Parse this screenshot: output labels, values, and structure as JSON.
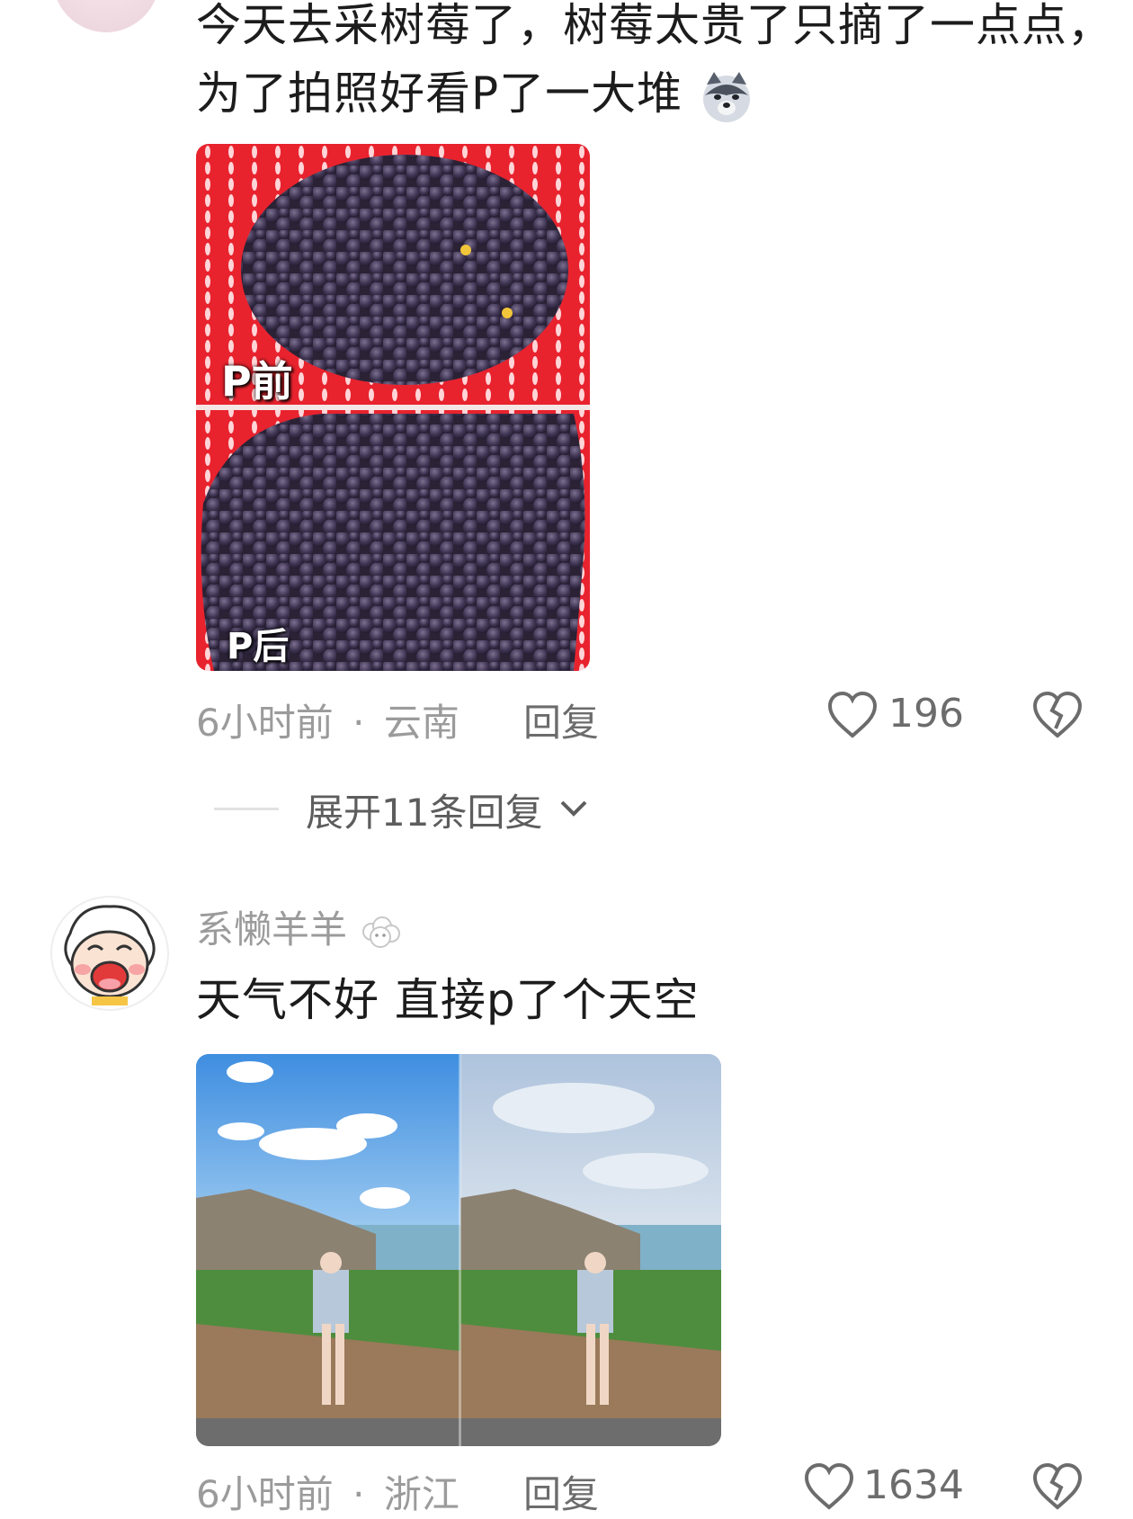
{
  "comments": [
    {
      "text_line1": "今天去采树莓了，树莓太贵了只摘了一点点，",
      "text_line2": "为了拍照好看P了一大堆",
      "emoji_icon": "husky-dog-emoji-icon",
      "photo_labels": {
        "before": "P前",
        "after": "P后"
      },
      "time": "6小时前",
      "separator": "·",
      "location": "云南",
      "reply_label": "回复",
      "likes": "196"
    },
    {
      "username": "系懒羊羊",
      "username_icon": "sheep-icon",
      "text": "天气不好 直接p了个天空",
      "time": "6小时前",
      "separator": "·",
      "location": "浙江",
      "reply_label": "回复",
      "likes": "1634"
    }
  ],
  "expand_replies_label": "展开11条回复",
  "colors": {
    "basket_red": "#e8232e",
    "berry": "#3b3350",
    "sky": "#4b9be0",
    "text_gray": "#9b9b9b"
  }
}
